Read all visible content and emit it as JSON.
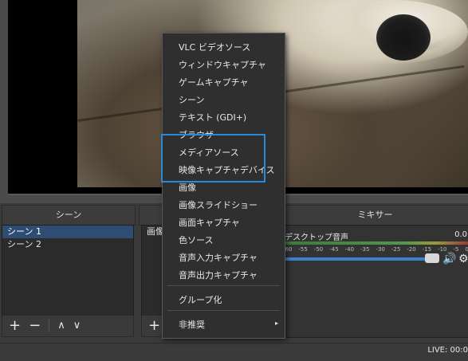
{
  "docks": {
    "scenes_title": "シーン",
    "sources_title": "",
    "mixer_title": "ミキサー"
  },
  "scenes": [
    "シーン 1",
    "シーン 2"
  ],
  "sources": [
    "画像"
  ],
  "mixer": {
    "track_name": "デスクトップ音声",
    "db_value": "0.0",
    "ticks": [
      "-60",
      "-55",
      "-50",
      "-45",
      "-40",
      "-35",
      "-30",
      "-25",
      "-20",
      "-15",
      "-10",
      "-5",
      "0"
    ],
    "volume_level": 0.92
  },
  "status": {
    "live": "LIVE: 00:0"
  },
  "context_menu": {
    "items": [
      {
        "label": "VLC ビデオソース"
      },
      {
        "label": "ウィンドウキャプチャ"
      },
      {
        "label": "ゲームキャプチャ"
      },
      {
        "label": "シーン"
      },
      {
        "label": "テキスト (GDI+)"
      },
      {
        "label": "ブラウザ"
      },
      {
        "label": "メディアソース"
      },
      {
        "label": "映像キャプチャデバイス"
      },
      {
        "label": "画像"
      },
      {
        "label": "画像スライドショー"
      },
      {
        "label": "画面キャプチャ"
      },
      {
        "label": "色ソース"
      },
      {
        "label": "音声入力キャプチャ"
      },
      {
        "label": "音声出力キャプチャ"
      },
      {
        "label": "グループ化"
      },
      {
        "label": "非推奨"
      }
    ]
  },
  "icons": {
    "add": "+",
    "remove": "−",
    "up": "∧",
    "down": "∨",
    "speaker": "🔊",
    "gear": "⚙",
    "submenu": "▸"
  },
  "colors": {
    "highlight": "#2a8ad8",
    "selection": "#2f4d73",
    "slider": "#3e7fc9"
  }
}
